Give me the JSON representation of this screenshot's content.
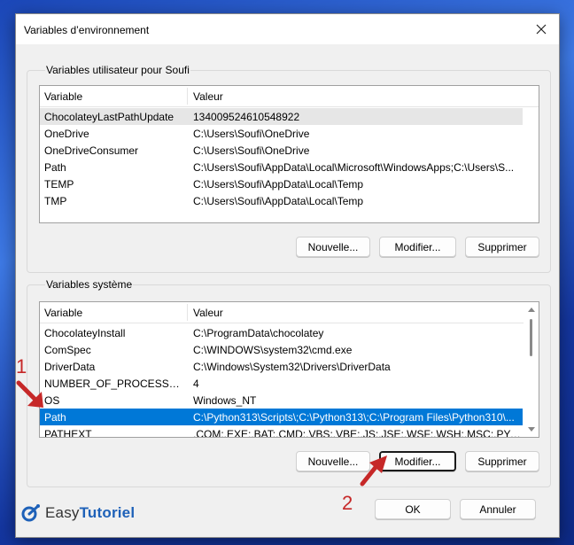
{
  "dialog": {
    "title": "Variables d’environnement"
  },
  "user_vars": {
    "group_label": "Variables utilisateur pour Soufi",
    "columns": [
      "Variable",
      "Valeur"
    ],
    "rows": [
      {
        "name": "ChocolateyLastPathUpdate",
        "value": "134009524610548922"
      },
      {
        "name": "OneDrive",
        "value": "C:\\Users\\Soufi\\OneDrive"
      },
      {
        "name": "OneDriveConsumer",
        "value": "C:\\Users\\Soufi\\OneDrive"
      },
      {
        "name": "Path",
        "value": "C:\\Users\\Soufi\\AppData\\Local\\Microsoft\\WindowsApps;C:\\Users\\S..."
      },
      {
        "name": "TEMP",
        "value": "C:\\Users\\Soufi\\AppData\\Local\\Temp"
      },
      {
        "name": "TMP",
        "value": "C:\\Users\\Soufi\\AppData\\Local\\Temp"
      }
    ],
    "buttons": {
      "new": "Nouvelle...",
      "edit": "Modifier...",
      "delete": "Supprimer"
    }
  },
  "system_vars": {
    "group_label": "Variables système",
    "columns": [
      "Variable",
      "Valeur"
    ],
    "rows": [
      {
        "name": "ChocolateyInstall",
        "value": "C:\\ProgramData\\chocolatey"
      },
      {
        "name": "ComSpec",
        "value": "C:\\WINDOWS\\system32\\cmd.exe"
      },
      {
        "name": "DriverData",
        "value": "C:\\Windows\\System32\\Drivers\\DriverData"
      },
      {
        "name": "NUMBER_OF_PROCESSORS",
        "value": "4"
      },
      {
        "name": "OS",
        "value": "Windows_NT"
      },
      {
        "name": "Path",
        "value": "C:\\Python313\\Scripts\\;C:\\Python313\\;C:\\Program Files\\Python310\\..."
      },
      {
        "name": "PATHEXT",
        "value": ".COM;.EXE;.BAT;.CMD;.VBS;.VBE;.JS;.JSE;.WSF;.WSH;.MSC;.PY;.PYW"
      }
    ],
    "buttons": {
      "new": "Nouvelle...",
      "edit": "Modifier...",
      "delete": "Supprimer"
    }
  },
  "footer": {
    "ok": "OK",
    "cancel": "Annuler"
  },
  "watermark": {
    "brand_plain": "Easy",
    "brand_bold": "Tutoriel"
  },
  "annotations": {
    "step1": "1",
    "step2": "2"
  },
  "colors": {
    "selection": "#0078d7",
    "annotation": "#c62828",
    "brand": "#1e61b8"
  }
}
